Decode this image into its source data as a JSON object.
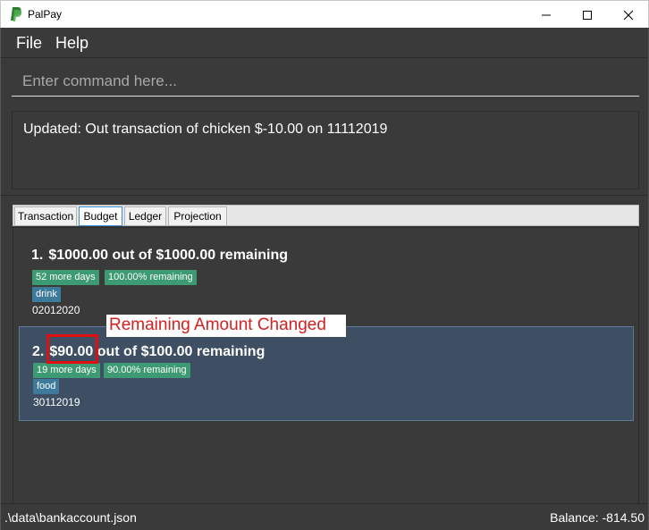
{
  "window": {
    "title": "PalPay",
    "minimize_icon": "minimize-icon",
    "maximize_icon": "maximize-icon",
    "close_icon": "close-icon",
    "logo_icon": "paypal-logo-icon",
    "logo_colors": [
      "#253b80",
      "#179bd7",
      "#4caf50"
    ]
  },
  "menu": {
    "file": "File",
    "help": "Help"
  },
  "command": {
    "placeholder": "Enter command here...",
    "value": ""
  },
  "result": {
    "text": "Updated: Out transaction of chicken $-10.00 on 11112019"
  },
  "tabs": [
    {
      "label": "Transaction",
      "selected": false
    },
    {
      "label": "Budget",
      "selected": true
    },
    {
      "label": "Ledger",
      "selected": false
    },
    {
      "label": "Projection",
      "selected": false
    }
  ],
  "budgets": [
    {
      "index": "1.",
      "amount": "$1000.00",
      "rest": "out of $1000.00 remaining",
      "days_badge": "52 more days",
      "percent_badge": "100.00% remaining",
      "category": "drink",
      "date": "02012020",
      "selected": false
    },
    {
      "index": "2.",
      "amount": "$90.00",
      "rest": "out of $100.00 remaining",
      "days_badge": "19 more days",
      "percent_badge": "90.00% remaining",
      "category": "food",
      "date": "30112019",
      "selected": true
    }
  ],
  "annotation": {
    "text": "Remaining Amount Changed",
    "color": "#e01010"
  },
  "status": {
    "path": ".\\data\\bankaccount.json",
    "balance": "Balance: -814.50"
  },
  "colors": {
    "background": "#3a3a3a",
    "selected_card": "#3f4f63",
    "badge_green": "#3e9a73",
    "badge_blue": "#3d7a9c"
  }
}
